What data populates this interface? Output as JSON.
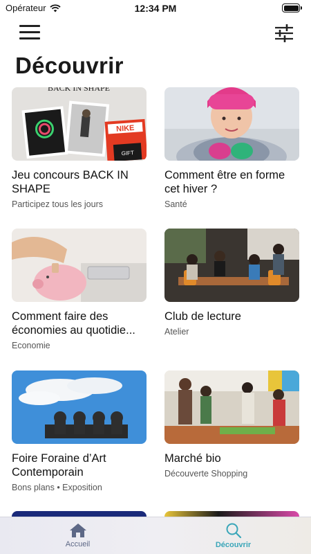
{
  "status": {
    "carrier": "Opérateur",
    "time": "12:34 PM"
  },
  "page": {
    "title": "Découvrir"
  },
  "cards": [
    {
      "title": "Jeu concours BACK IN SHAPE",
      "subtitle": "Participez tous les jours",
      "image": "back-in-shape-photo"
    },
    {
      "title": "Comment être en forme cet hiver ?",
      "subtitle": "Santé",
      "image": "winter-woman-photo"
    },
    {
      "title": "Comment faire des économies au quotidie...",
      "subtitle": "Economie",
      "image": "piggy-bank-photo"
    },
    {
      "title": "Club de lecture",
      "subtitle": "Atelier",
      "image": "reading-club-photo"
    },
    {
      "title": "Foire Foraine d’Art Contemporain",
      "subtitle": "Bons plans • Exposition",
      "image": "statues-sky-photo"
    },
    {
      "title": "Marché bio",
      "subtitle": "Découverte Shopping",
      "image": "market-photo"
    }
  ],
  "thumb_text": {
    "back_in_shape": "BACK IN SHAPE",
    "nike": "NIKE",
    "gift": "GIFT"
  },
  "tabs": [
    {
      "label": "Accueil",
      "icon": "home-icon",
      "active": false
    },
    {
      "label": "Découvrir",
      "icon": "search-icon",
      "active": true
    }
  ],
  "colors": {
    "accent": "#3aa6b9",
    "inactive_tab": "#5d6886"
  }
}
